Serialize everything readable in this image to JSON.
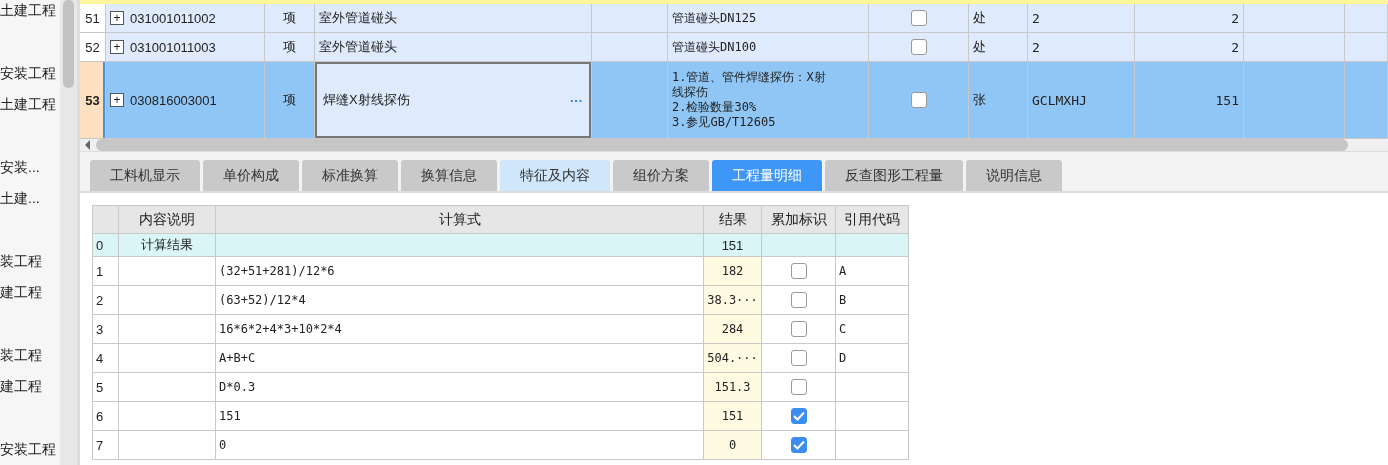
{
  "sidebar": {
    "items": [
      "土建工程",
      "安装工程",
      "土建工程",
      "安装...",
      "土建...",
      "装工程",
      "建工程",
      "装工程",
      "建工程",
      "安装工程"
    ]
  },
  "bill_rows": [
    {
      "row_number": "51",
      "expand_icon": "+",
      "code": "031001011002",
      "type": "项",
      "name": "室外管道碰头",
      "features": [
        "管道碰头DN125"
      ],
      "checked": false,
      "unit": "处",
      "expression": "2",
      "quantity": "2",
      "selected": false
    },
    {
      "row_number": "52",
      "expand_icon": "+",
      "code": "031001011003",
      "type": "项",
      "name": "室外管道碰头",
      "features": [
        "管道碰头DN100"
      ],
      "checked": false,
      "unit": "处",
      "expression": "2",
      "quantity": "2",
      "selected": false
    },
    {
      "row_number": "53",
      "expand_icon": "+",
      "code": "030816003001",
      "type": "项",
      "name": "焊缝X射线探伤",
      "more_button": "···",
      "features": [
        "1.管道、管件焊缝探伤：X射",
        "线探伤",
        "2.检验数量30%",
        "3.参见GB/T12605"
      ],
      "checked": false,
      "unit": "张",
      "expression": "GCLMXHJ",
      "quantity": "151",
      "selected": true
    }
  ],
  "tabs": [
    {
      "label": "工料机显示",
      "selected": false,
      "kind": "normal"
    },
    {
      "label": "单价构成",
      "selected": false,
      "kind": "normal"
    },
    {
      "label": "标准换算",
      "selected": false,
      "kind": "normal"
    },
    {
      "label": "换算信息",
      "selected": false,
      "kind": "normal"
    },
    {
      "label": "特征及内容",
      "selected": false,
      "kind": "light"
    },
    {
      "label": "组价方案",
      "selected": false,
      "kind": "normal"
    },
    {
      "label": "工程量明细",
      "selected": true,
      "kind": "normal"
    },
    {
      "label": "反查图形工程量",
      "selected": false,
      "kind": "normal"
    },
    {
      "label": "说明信息",
      "selected": false,
      "kind": "normal"
    }
  ],
  "detail_table": {
    "columns": [
      "内容说明",
      "计算式",
      "结果",
      "累加标识",
      "引用代码"
    ],
    "rows": [
      {
        "index": "0",
        "description": "计算结果",
        "formula": "",
        "result": "151",
        "kind": "total"
      },
      {
        "index": "1",
        "formula": "(32+51+281)/12*6",
        "result": "182",
        "accumulate": false,
        "code": "A",
        "kind": "line"
      },
      {
        "index": "2",
        "formula": "(63+52)/12*4",
        "result": "38.3···",
        "accumulate": false,
        "code": "B",
        "kind": "line"
      },
      {
        "index": "3",
        "formula": "16*6*2+4*3+10*2*4",
        "result": "284",
        "accumulate": false,
        "code": "C",
        "kind": "line"
      },
      {
        "index": "4",
        "formula": "A+B+C",
        "result": "504.···",
        "accumulate": false,
        "code": "D",
        "kind": "line"
      },
      {
        "index": "5",
        "formula": "D*0.3",
        "result": "151.3",
        "accumulate": false,
        "kind": "line"
      },
      {
        "index": "6",
        "formula": "151",
        "result": "151",
        "accumulate": true,
        "kind": "line"
      },
      {
        "index": "7",
        "formula": "0",
        "result": "0",
        "accumulate": true,
        "kind": "line"
      }
    ]
  }
}
